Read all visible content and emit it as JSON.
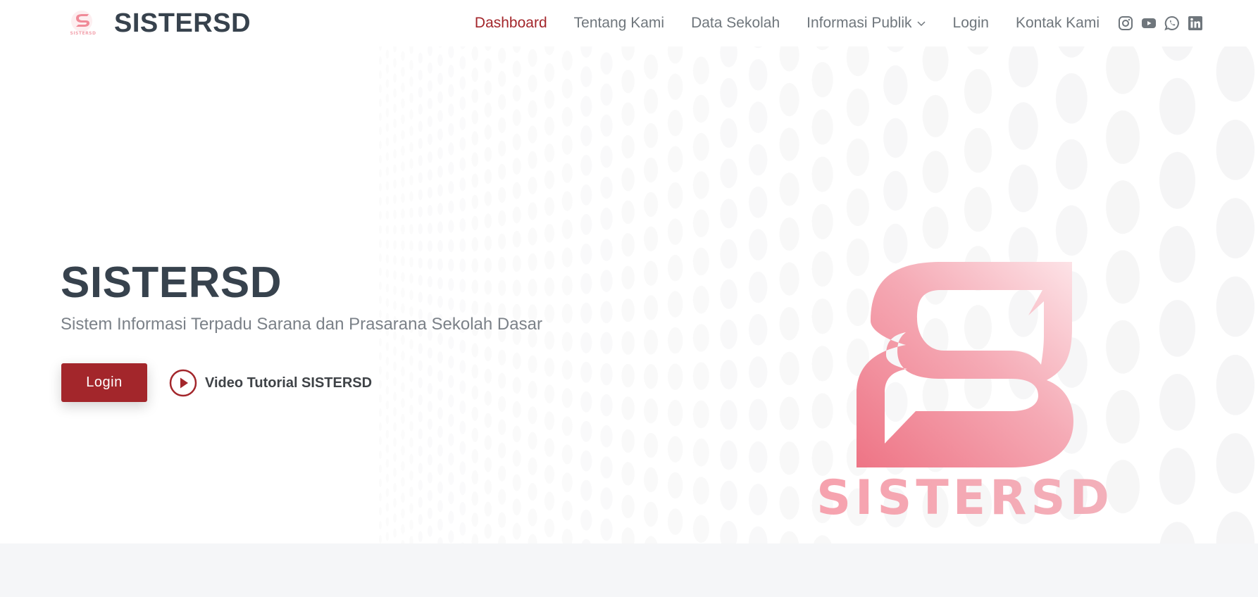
{
  "brand": {
    "name": "SISTERSD",
    "logo_text": "SISTERSD"
  },
  "nav": {
    "items": [
      {
        "label": "Dashboard",
        "active": true
      },
      {
        "label": "Tentang Kami"
      },
      {
        "label": "Data Sekolah"
      },
      {
        "label": "Informasi Publik",
        "has_dropdown": true
      },
      {
        "label": "Login"
      },
      {
        "label": "Kontak Kami"
      }
    ],
    "socials": [
      "instagram-icon",
      "youtube-icon",
      "whatsapp-icon",
      "linkedin-icon"
    ]
  },
  "hero": {
    "title": "SISTERSD",
    "subtitle": "Sistem Informasi Terpadu Sarana dan Prasarana Sekolah Dasar",
    "login_button": "Login",
    "video_link": "Video Tutorial SISTERSD",
    "logo_text": "SISTERSD"
  },
  "colors": {
    "accent": "#a3262b",
    "heading": "#37424d",
    "nav_text": "#6f767c",
    "logo_pink": "#f08a98",
    "band": "#f5f6f8"
  }
}
